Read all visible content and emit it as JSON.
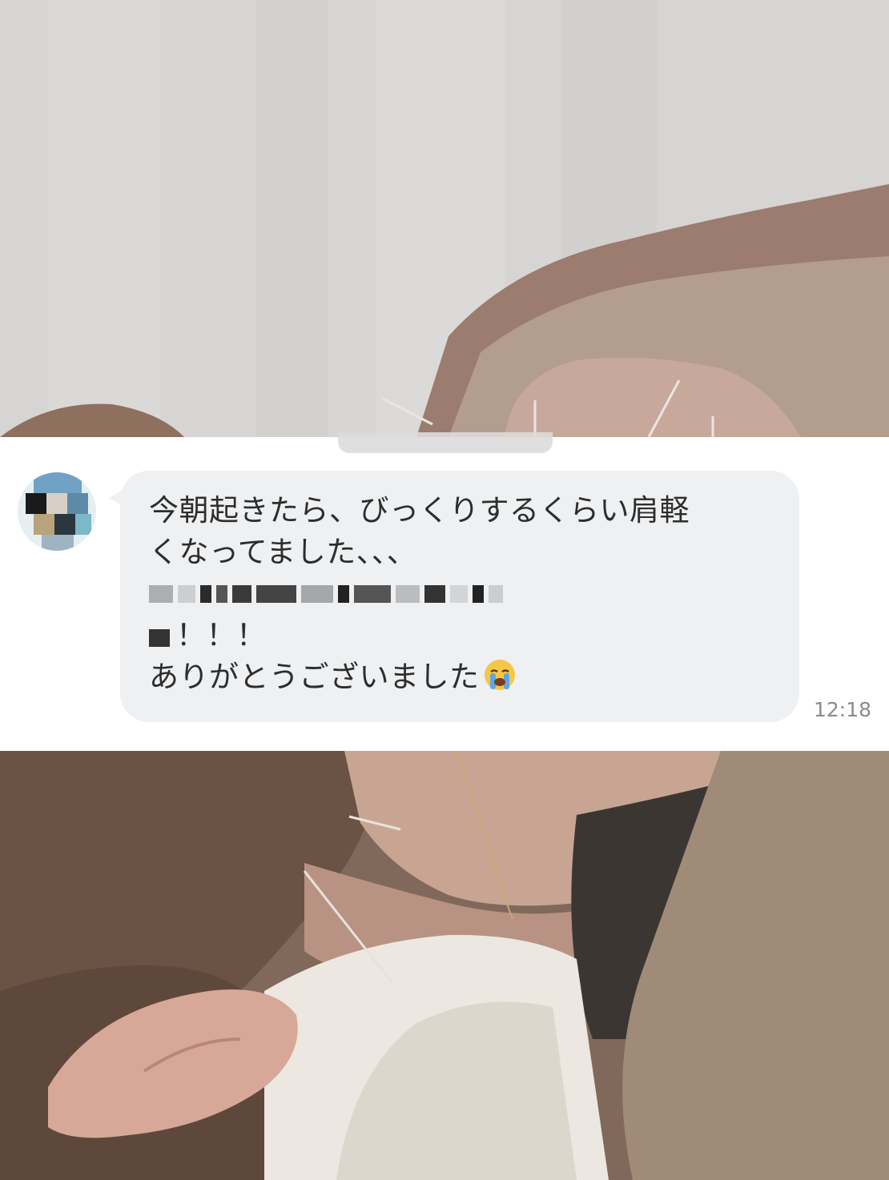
{
  "chat": {
    "message_lines": [
      "今朝起きたら、びっくりするくらい肩軽",
      "くなってました、、、",
      "",
      "！！！",
      "ありがとうございました"
    ],
    "emoji": "loudly-crying-face",
    "time": "12:18"
  },
  "colors": {
    "bubble": "#eef0f2",
    "text": "#2d2d2d",
    "timestamp": "#8b8b8b"
  }
}
